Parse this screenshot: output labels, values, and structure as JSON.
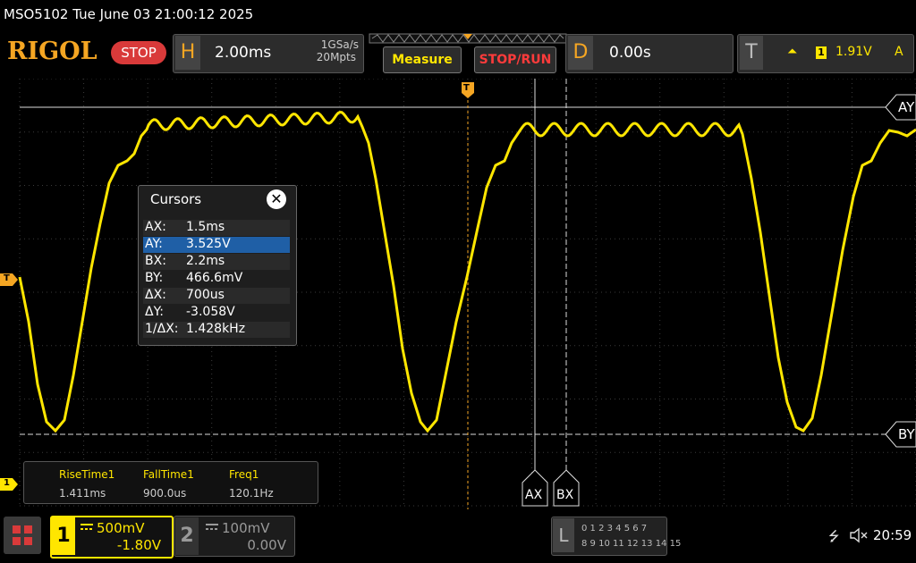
{
  "title_bar": {
    "text": "MSO5102  Tue June 03 21:00:12 2025"
  },
  "brand": {
    "logo": "RIGOL",
    "run_state": "STOP"
  },
  "horizontal": {
    "letter": "H",
    "timebase": "2.00ms",
    "sample_rate": "1GSa/s",
    "memory_depth": "20Mpts"
  },
  "buttons": {
    "measure": "Measure",
    "stop_run": "STOP/RUN"
  },
  "delay": {
    "letter": "D",
    "value": "0.00s"
  },
  "trigger": {
    "letter": "T",
    "edge_icon": "rising-edge-icon",
    "edge_glyph": "⏶",
    "source": "1",
    "level": "1.91V",
    "mode": "A"
  },
  "markers": {
    "trigger_marker": "T",
    "ch1_marker": "1",
    "ay_label": "AY",
    "by_label": "BY",
    "ax_label": "AX",
    "bx_label": "BX"
  },
  "cursor_panel": {
    "title": "Cursors",
    "close_glyph": "✕",
    "rows": [
      {
        "key": "AX:",
        "value": "1.5ms"
      },
      {
        "key": "AY:",
        "value": "3.525V"
      },
      {
        "key": "BX:",
        "value": "2.2ms"
      },
      {
        "key": "BY:",
        "value": "466.6mV"
      },
      {
        "key": "ΔX:",
        "value": "700us"
      },
      {
        "key": "ΔY:",
        "value": "-3.058V"
      },
      {
        "key": "1/ΔX:",
        "value": "1.428kHz"
      }
    ],
    "selected_row": 1
  },
  "measurements": [
    {
      "label": "RiseTime1",
      "value": "1.411ms"
    },
    {
      "label": "FallTime1",
      "value": "900.0us"
    },
    {
      "label": "Freq1",
      "value": "120.1Hz"
    }
  ],
  "channel1": {
    "number": "1",
    "scale": "500mV",
    "offset": "-1.80V",
    "color": "#ffe600"
  },
  "channel2": {
    "number": "2",
    "scale": "100mV",
    "offset": "0.00V",
    "color": "#999999"
  },
  "logic": {
    "letter": "L",
    "row1": "0 1 2 3   4 5 6 7",
    "row2": "8 9 10 11  12 13 14 15"
  },
  "status": {
    "usb_icon": "usb-icon",
    "usb_glyph": "⭍",
    "speaker_icon": "speaker-muted-icon",
    "speaker_glyph": "🔇",
    "time": "20:59"
  },
  "colors": {
    "trace": "#ffe600",
    "logo": "#f5a623",
    "stop": "#d93a3a",
    "selected": "#1f5fa6"
  }
}
